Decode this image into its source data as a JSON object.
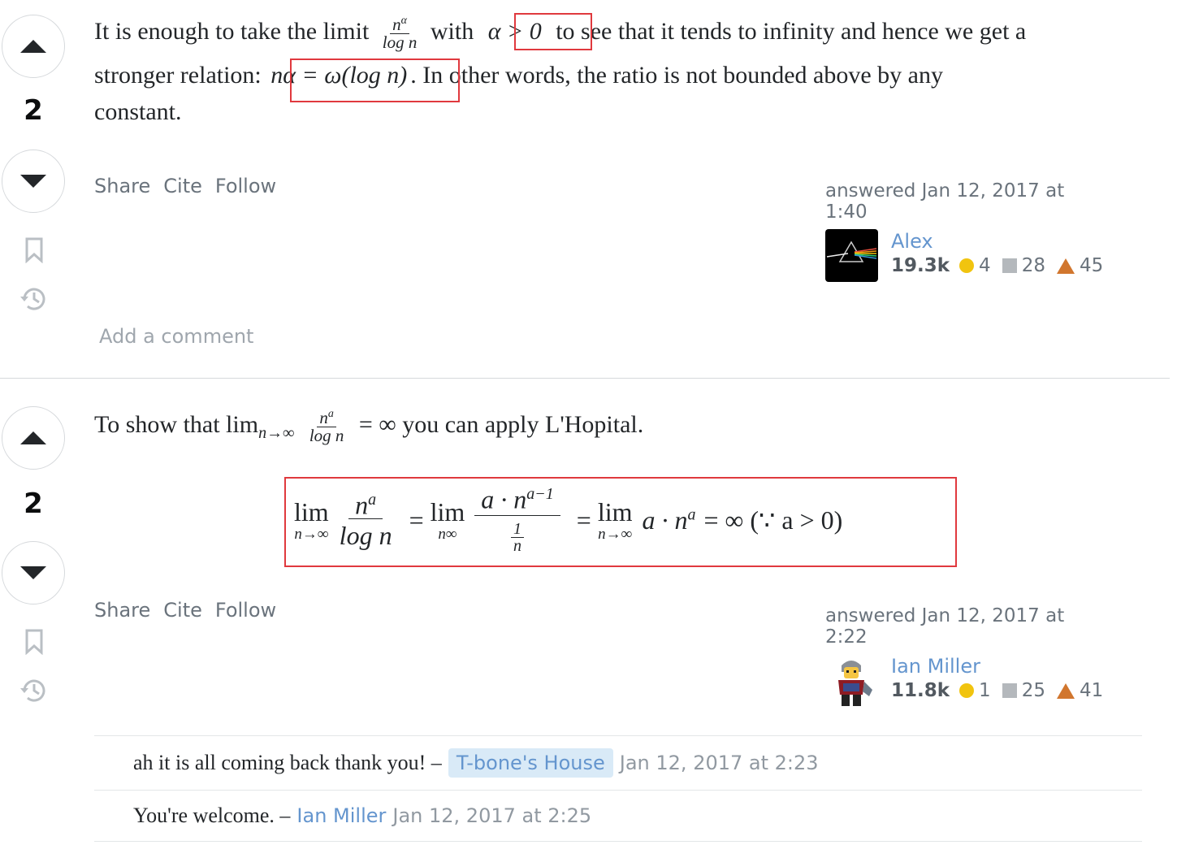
{
  "answers": [
    {
      "vote_count": "2",
      "body": {
        "part1": "It is enough to take the limit",
        "frac_num": "n",
        "frac_num_sup": "α",
        "frac_den": "log n",
        "part2": "with",
        "boxed1": "α > 0",
        "part3": "to see that it tends to infinity and hence we get a",
        "part4": "stronger relation:",
        "boxed2": "nα = ω(log n)",
        "part5": ". In other words, the ratio is not bounded above by any",
        "part6": "constant."
      },
      "actions": {
        "share": "Share",
        "cite": "Cite",
        "follow": "Follow"
      },
      "signature": {
        "action": "answered Jan 12, 2017 at 1:40",
        "user_name": "Alex",
        "reputation": "19.3k",
        "gold": "4",
        "silver": "28",
        "bronze": "45"
      },
      "add_comment": "Add a comment"
    },
    {
      "vote_count": "2",
      "body": {
        "part1": "To show that lim",
        "lim_sub": "n→∞",
        "frac_num": "n",
        "frac_num_sup": "a",
        "frac_den": "log n",
        "part2": "= ∞ you can apply L'Hopital."
      },
      "equation": {
        "lim": "lim",
        "lim_sub1": "n→∞",
        "f1_num": "n",
        "f1_num_sup": "a",
        "f1_den": "log n",
        "eq": "=",
        "lim_sub2": "n∞",
        "f2_num": "a · n",
        "f2_num_sup": "a−1",
        "f2_den_num": "1",
        "f2_den_den": "n",
        "lim_sub3": "n→∞",
        "tail": "a · n",
        "tail_sup": "a",
        "result": "= ∞ (∵ a > 0)"
      },
      "actions": {
        "share": "Share",
        "cite": "Cite",
        "follow": "Follow"
      },
      "signature": {
        "action": "answered Jan 12, 2017 at 2:22",
        "user_name": "Ian Miller",
        "reputation": "11.8k",
        "gold": "1",
        "silver": "25",
        "bronze": "41"
      },
      "comments": [
        {
          "text": "ah it is all coming back thank you! –",
          "user": "T-bone's House",
          "date": "Jan 12, 2017 at 2:23"
        },
        {
          "text": "You're welcome. –",
          "user": "Ian Miller",
          "date": "Jan 12, 2017 at 2:25"
        }
      ]
    }
  ],
  "colors": {
    "link": "#6495ce",
    "highlight_box": "#e0393e",
    "gold": "#f1c40f",
    "silver": "#b4b8bc",
    "bronze": "#d1762e"
  }
}
